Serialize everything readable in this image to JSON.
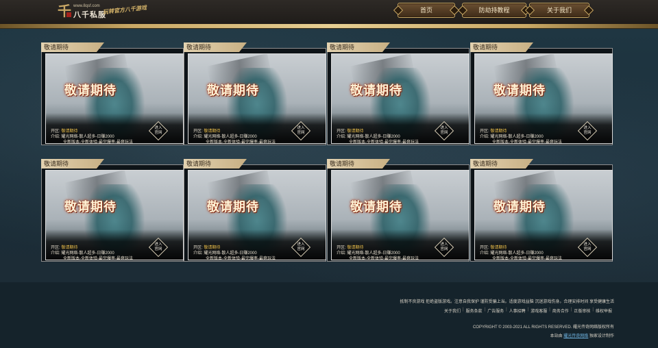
{
  "header": {
    "logo_mark": "千",
    "logo_url": "www.8qsf.com",
    "logo_name": "八千私服",
    "logo_slogan": "玩转官方八千游戏",
    "nav": [
      "首页",
      "防劫持教程",
      "关于我们"
    ]
  },
  "cards": [
    {
      "tag": "敬请期待",
      "title": "敬请期待",
      "open_label": "开区:",
      "open_value": "敬请期待",
      "intro_label": "介绍:",
      "intro_line1": "耀光网络-散人超多-日赚2000",
      "intro_line2": "全新版本-全新体验-最完爆率-最爽玩法",
      "enter_line1": "进入",
      "enter_line2": "官网"
    },
    {
      "tag": "敬请期待",
      "title": "敬请期待",
      "open_label": "开区:",
      "open_value": "敬请期待",
      "intro_label": "介绍:",
      "intro_line1": "耀光网络-散人超多-日赚2000",
      "intro_line2": "全新版本-全新体验-最完爆率-最爽玩法",
      "enter_line1": "进入",
      "enter_line2": "官网"
    },
    {
      "tag": "敬请期待",
      "title": "敬请期待",
      "open_label": "开区:",
      "open_value": "敬请期待",
      "intro_label": "介绍:",
      "intro_line1": "耀光网络-散人超多-日赚2000",
      "intro_line2": "全新版本-全新体验-最完爆率-最爽玩法",
      "enter_line1": "进入",
      "enter_line2": "官网"
    },
    {
      "tag": "敬请期待",
      "title": "敬请期待",
      "open_label": "开区:",
      "open_value": "敬请期待",
      "intro_label": "介绍:",
      "intro_line1": "耀光网络-散人超多-日赚2000",
      "intro_line2": "全新版本-全新体验-最完爆率-最爽玩法",
      "enter_line1": "进入",
      "enter_line2": "官网"
    },
    {
      "tag": "敬请期待",
      "title": "敬请期待",
      "open_label": "开区:",
      "open_value": "敬请期待",
      "intro_label": "介绍:",
      "intro_line1": "耀光网络-散人超多-日赚2000",
      "intro_line2": "全新版本-全新体验-最完爆率-最爽玩法",
      "enter_line1": "进入",
      "enter_line2": "官网"
    },
    {
      "tag": "敬请期待",
      "title": "敬请期待",
      "open_label": "开区:",
      "open_value": "敬请期待",
      "intro_label": "介绍:",
      "intro_line1": "耀光网络-散人超多-日赚2000",
      "intro_line2": "全新版本-全新体验-最完爆率-最爽玩法",
      "enter_line1": "进入",
      "enter_line2": "官网"
    },
    {
      "tag": "敬请期待",
      "title": "敬请期待",
      "open_label": "开区:",
      "open_value": "敬请期待",
      "intro_label": "介绍:",
      "intro_line1": "耀光网络-散人超多-日赚2000",
      "intro_line2": "全新版本-全新体验-最完爆率-最爽玩法",
      "enter_line1": "进入",
      "enter_line2": "官网"
    },
    {
      "tag": "敬请期待",
      "title": "敬请期待",
      "open_label": "开区:",
      "open_value": "敬请期待",
      "intro_label": "介绍:",
      "intro_line1": "耀光网络-散人超多-日赚2000",
      "intro_line2": "全新版本-全新体验-最完爆率-最爽玩法",
      "enter_line1": "进入",
      "enter_line2": "官网"
    }
  ],
  "footer": {
    "notice": "抵制不良游戏 拒绝盗版游戏。注意自我保护 谨防受骗上当。适度游戏益脑 沉迷游戏伤身。合理安排时间 享受健康生活",
    "links": [
      "关于我们",
      "服务条款",
      "广告服务",
      "人事招聘",
      "游戏客服",
      "商务合作",
      "正版审核",
      "维权举报"
    ],
    "copyright": "COPYRIGHT © 2003-2021 ALL RIGHTS RESERVED. 耀光传奇网络版权所有",
    "credit_prefix": "本站由",
    "credit_link": "耀光传奇网络",
    "credit_suffix": "独家设计制作"
  }
}
